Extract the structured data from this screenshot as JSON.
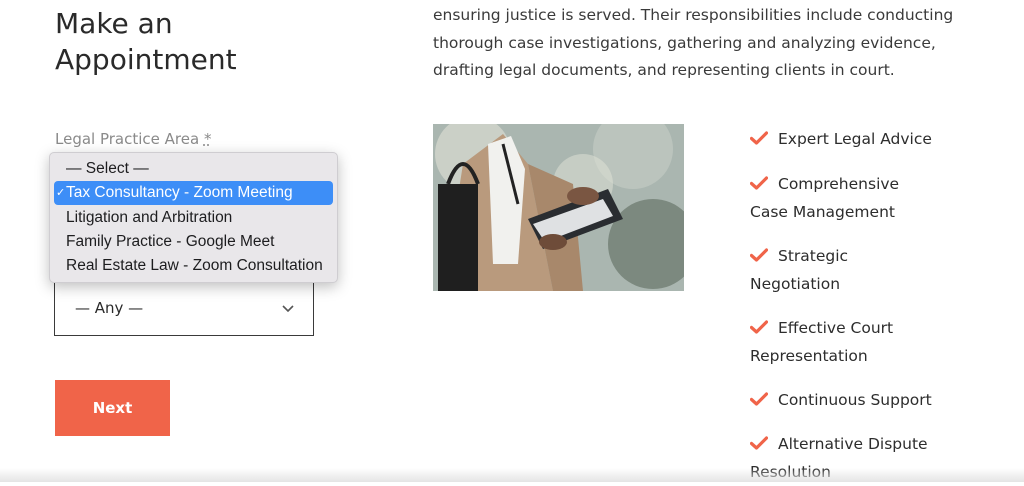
{
  "form": {
    "title_line1": "Make an",
    "title_line2": "Appointment",
    "field_label": "Legal Practice Area",
    "required_mark": "*",
    "dropdown_options": [
      "— Select —",
      "Tax Consultancy - Zoom Meeting",
      "Litigation and Arbitration",
      "Family Practice - Google Meet",
      "Real Estate Law - Zoom Consultation"
    ],
    "selected_index": 1,
    "check_glyph": "✓",
    "second_select_value": "— Any —",
    "next_label": "Next"
  },
  "content": {
    "paragraph_lines": [
      "ensuring justice is served. Their responsibilities include conducting",
      "thorough case investigations, gathering and analyzing evidence,",
      "drafting legal documents, and representing clients in court."
    ],
    "features": [
      [
        "Expert Legal Advice"
      ],
      [
        "Comprehensive",
        "Case Management"
      ],
      [
        "Strategic",
        "Negotiation"
      ],
      [
        "Effective Court",
        "Representation"
      ],
      [
        "Continuous Support"
      ],
      [
        "Alternative Dispute",
        "Resolution"
      ]
    ]
  },
  "colors": {
    "accent": "#f06449",
    "selected_option": "#3d8ef7"
  },
  "icons": {
    "feature_check": "check-icon",
    "select_chevron": "chevron-down-icon"
  }
}
